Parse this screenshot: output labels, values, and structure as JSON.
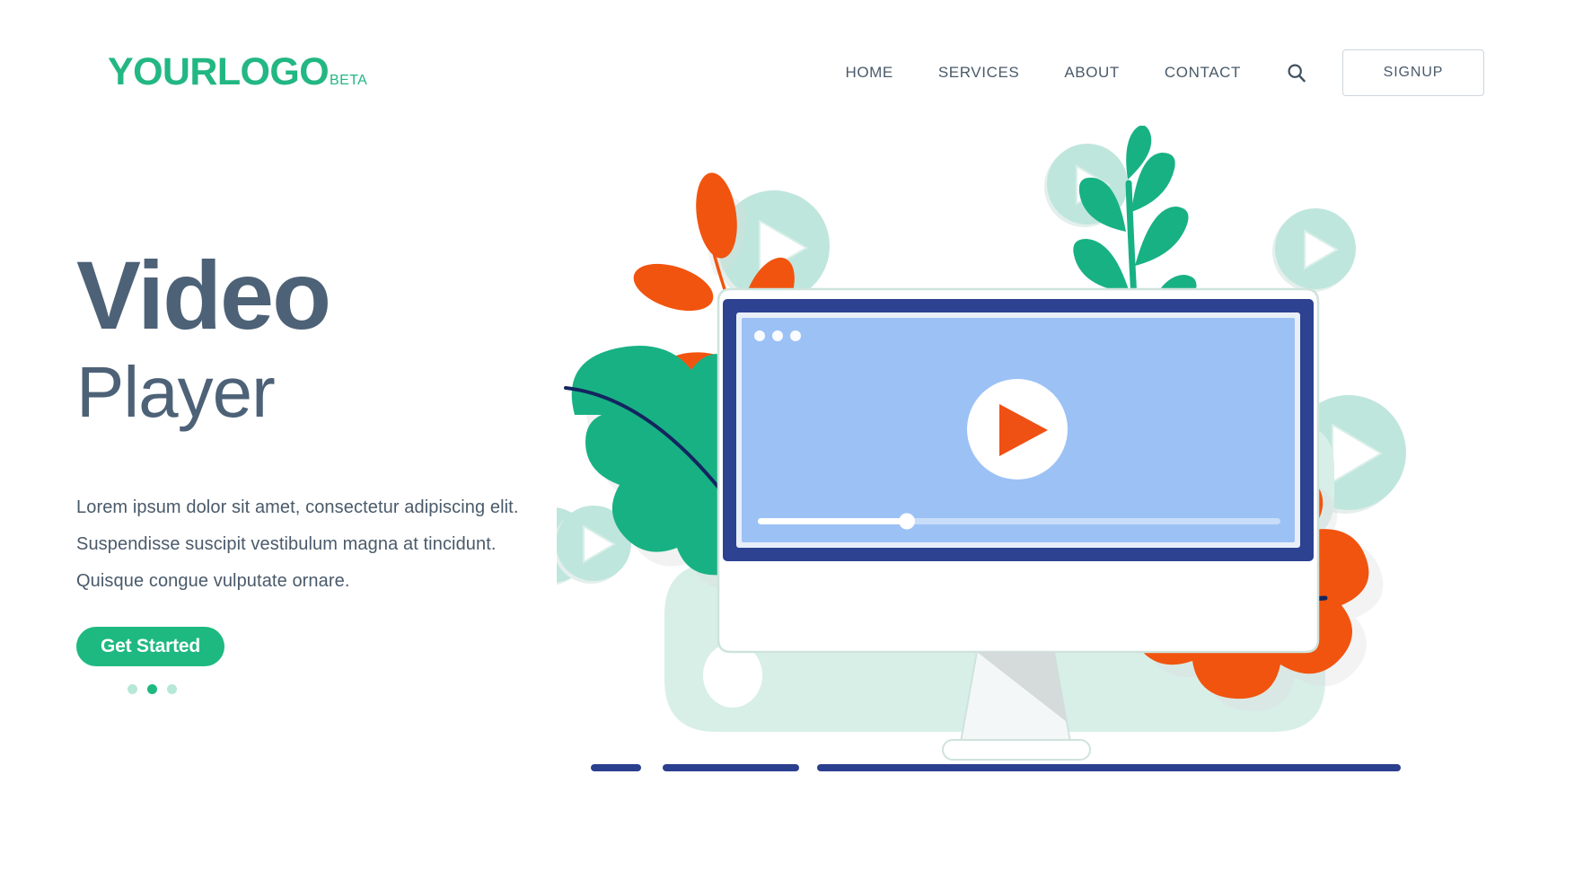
{
  "header": {
    "logo": {
      "main": "YOURLOGO",
      "suffix": "BETA",
      "color": "#22b783"
    },
    "nav": [
      {
        "label": "HOME"
      },
      {
        "label": "SERVICES"
      },
      {
        "label": "ABOUT"
      },
      {
        "label": "CONTACT"
      }
    ],
    "search_icon": "search-icon",
    "signup_label": "SIGNUP"
  },
  "hero": {
    "title_line1": "Video",
    "title_line2": "Player",
    "title_color": "#4d6277",
    "paragraph": [
      "Lorem ipsum dolor sit amet, consectetur adipiscing elit.",
      "Suspendisse suscipit vestibulum magna at tincidunt.",
      "Quisque congue vulputate ornare."
    ],
    "cta_label": "Get Started",
    "cta_color": "#1eb980",
    "carousel": {
      "total": 3,
      "active_index": 1
    }
  },
  "illustration": {
    "name": "video-player-monitor-illustration",
    "colors": {
      "monitor_bezel": "#2d4291",
      "screen": "#9cc1f5",
      "screen_inner_border": "#e8eff8",
      "play_button_circle": "#ffffff",
      "play_triangle": "#ef5014",
      "mint": "#bfe6dd",
      "mint_light": "#d8efe8",
      "green": "#18b184",
      "orange": "#f1540f",
      "navy_line": "#2b3f8f",
      "shadow": "#eceeed"
    },
    "screen_dots": 3,
    "progress_percent": 28,
    "decorative_play_circles": 6
  }
}
